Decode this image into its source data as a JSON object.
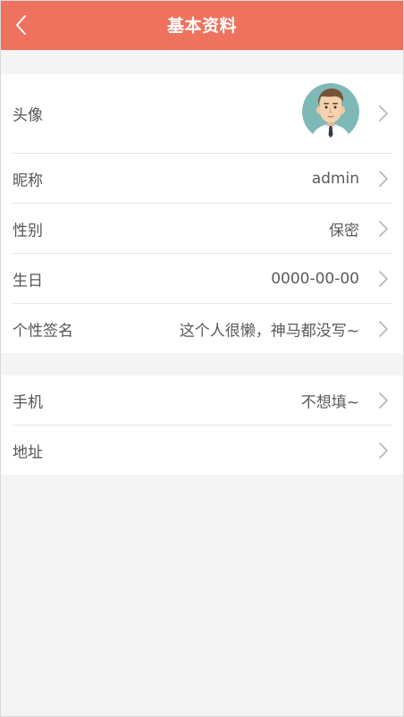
{
  "header": {
    "title": "基本资料",
    "back_icon": "chevron-left-icon",
    "background": "#ee725d"
  },
  "profile": {
    "avatar": {
      "label": "头像",
      "image": "cartoon-man-avatar"
    },
    "nickname": {
      "label": "昵称",
      "value": "admin"
    },
    "gender": {
      "label": "性别",
      "value": "保密"
    },
    "birthday": {
      "label": "生日",
      "value": "0000-00-00"
    },
    "signature": {
      "label": "个性签名",
      "value": "这个人很懒，神马都没写~"
    }
  },
  "contact": {
    "phone": {
      "label": "手机",
      "value": "不想填~"
    },
    "address": {
      "label": "地址",
      "value": ""
    }
  },
  "icons": {
    "row_arrow": "chevron-right-icon"
  }
}
